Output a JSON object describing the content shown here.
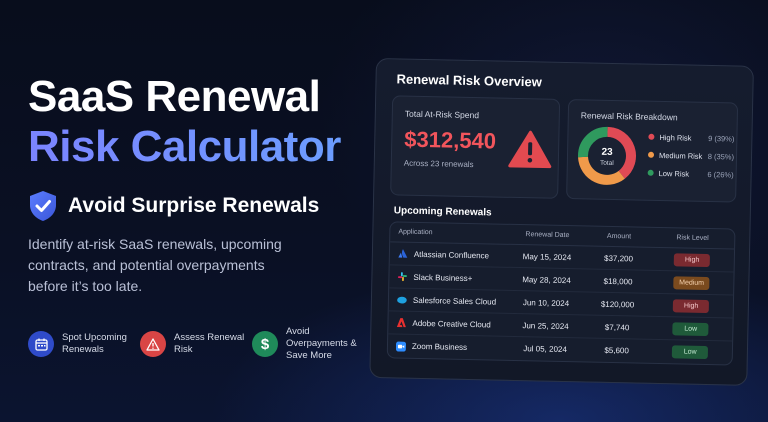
{
  "hero": {
    "title_line1": "SaaS Renewal",
    "title_line2": "Risk Calculator",
    "subtitle": "Avoid Surprise Renewals",
    "description": "Identify at-risk SaaS renewals, upcoming contracts, and potential overpayments before it’s too late."
  },
  "features": [
    {
      "label": "Spot Upcoming Renewals",
      "icon": "calendar-icon",
      "color": "#2f4bc9"
    },
    {
      "label": "Assess Renewal Risk",
      "icon": "warning-icon",
      "color": "#d94545"
    },
    {
      "label": "Avoid Overpayments & Save More",
      "icon": "dollar-icon",
      "color": "#1f8a5a"
    }
  ],
  "panel": {
    "title": "Renewal Risk Overview",
    "at_risk": {
      "label": "Total At-Risk Spend",
      "value": "$312,540",
      "sub": "Across 23 renewals"
    },
    "breakdown": {
      "title": "Renewal Risk Breakdown",
      "total_number": "23",
      "total_label": "Total",
      "items": [
        {
          "name": "High Risk",
          "value": "9 (39%)",
          "count": 9,
          "color": "#e04a55"
        },
        {
          "name": "Medium Risk",
          "value": "8 (35%)",
          "count": 8,
          "color": "#f09a4a"
        },
        {
          "name": "Low Risk",
          "value": "6 (26%)",
          "count": 6,
          "color": "#2f9a5e"
        }
      ]
    },
    "upcoming": {
      "title": "Upcoming Renewals",
      "headers": [
        "Application",
        "Renewal Date",
        "Amount",
        "Risk Level"
      ],
      "rows": [
        {
          "app": "Atlassian Confluence",
          "date": "May 15, 2024",
          "amount": "$37,200",
          "risk": "High",
          "icon": "atlassian-icon"
        },
        {
          "app": "Slack Business+",
          "date": "May 28, 2024",
          "amount": "$18,000",
          "risk": "Medium",
          "icon": "slack-icon"
        },
        {
          "app": "Salesforce Sales Cloud",
          "date": "Jun 10, 2024",
          "amount": "$120,000",
          "risk": "High",
          "icon": "salesforce-icon"
        },
        {
          "app": "Adobe Creative Cloud",
          "date": "Jun 25, 2024",
          "amount": "$7,740",
          "risk": "Low",
          "icon": "adobe-icon"
        },
        {
          "app": "Zoom Business",
          "date": "Jul 05, 2024",
          "amount": "$5,600",
          "risk": "Low",
          "icon": "zoom-icon"
        }
      ]
    }
  },
  "colors": {
    "high": "#7a2a30",
    "high_text": "#f6c9cc",
    "medium": "#7a4a1e",
    "medium_text": "#f7d3b0",
    "low": "#1f5a3a",
    "low_text": "#bfe8cf"
  }
}
